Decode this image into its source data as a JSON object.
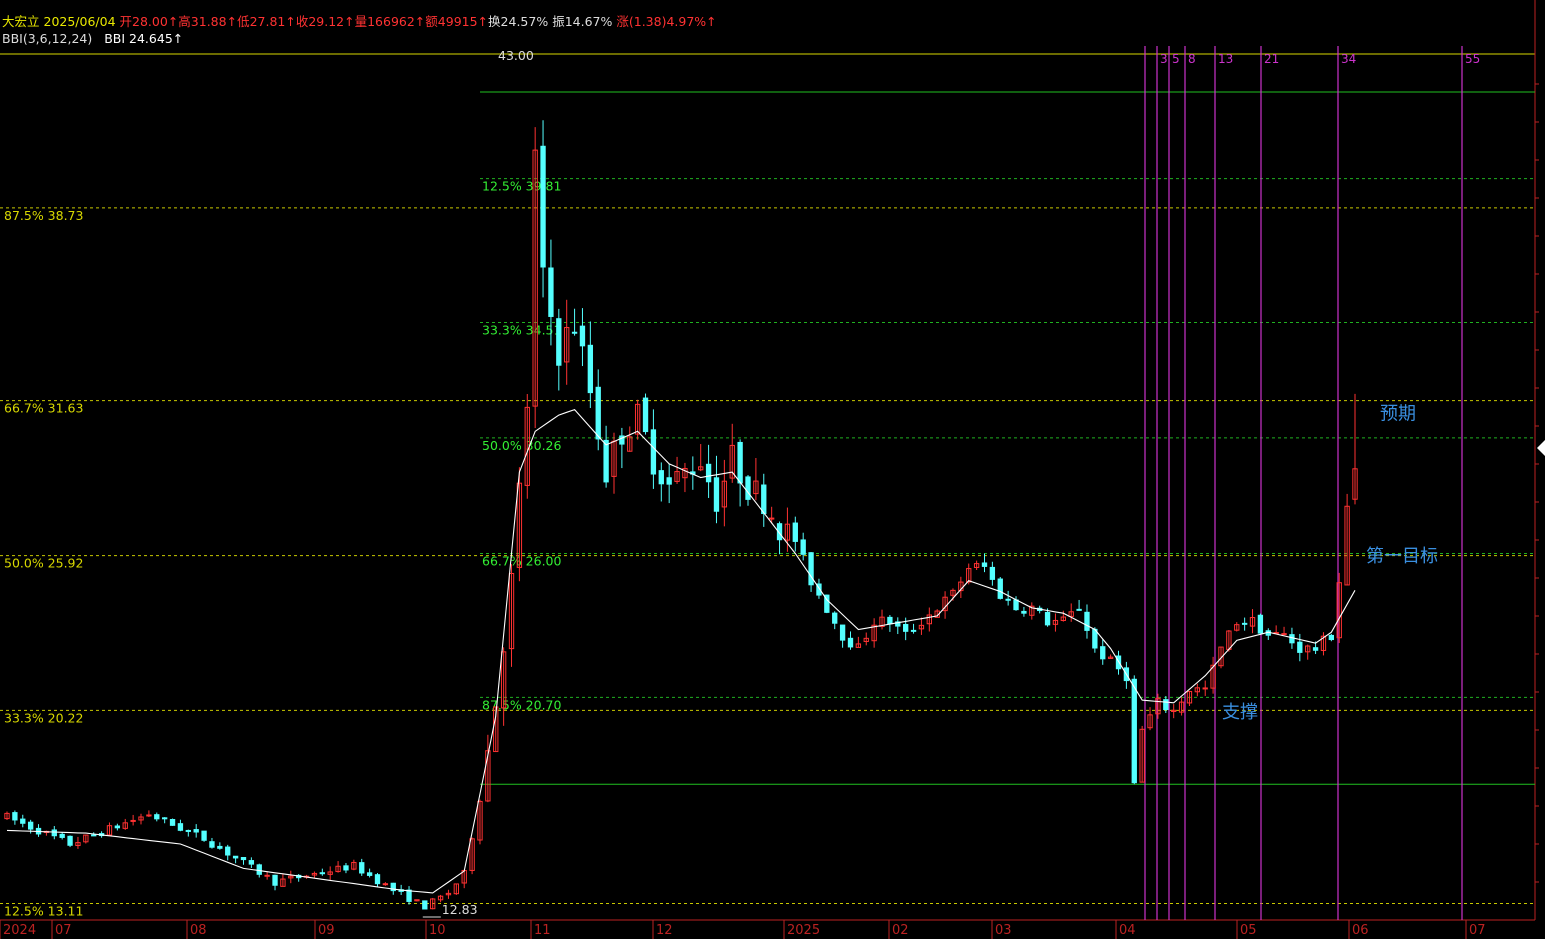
{
  "header": {
    "stock_name": "大宏立",
    "date": "2025/06/04",
    "open": "开28.00↑",
    "high": "高31.88↑",
    "low": "低27.81↑",
    "close": "收29.12↑",
    "volume": "量166962↑",
    "amount": "额49915↑",
    "turnover": "换24.57%",
    "amplitude": "振14.67%",
    "change": "涨(1.38)4.97%↑",
    "indicator_name": "BBI(3,6,12,24)",
    "indicator_value": "BBI 24.645↑"
  },
  "colors": {
    "background": "#000000",
    "up": "#ff3232",
    "down": "#54ffff",
    "fib_left": "#d8d800",
    "fib_right": "#33ee33",
    "fib_line_right": "#20c020",
    "time_lines": "#cc33cc",
    "bbi": "#ffffff",
    "annotation": "#3a8fe0",
    "axis": "#bb2222"
  },
  "chart_data": {
    "type": "candlestick",
    "y_scale": "linear",
    "ylim": [
      12.5,
      44.4
    ],
    "x_axis_labels": [
      "2024",
      "07",
      "08",
      "09",
      "10",
      "11",
      "12",
      "2025",
      "02",
      "03",
      "04",
      "05",
      "06",
      "07"
    ],
    "high_marker": "43.00",
    "low_marker": "12.83",
    "fib_left": [
      {
        "label": "87.5% 38.73",
        "value": 38.73
      },
      {
        "label": "66.7% 31.63",
        "value": 31.63
      },
      {
        "label": "50.0% 25.92",
        "value": 25.92
      },
      {
        "label": "33.3% 20.22",
        "value": 20.22
      },
      {
        "label": "12.5% 13.11",
        "value": 13.11
      }
    ],
    "fib_right": [
      {
        "label": "12.5% 39.81",
        "value": 39.81
      },
      {
        "label": "33.3% 34.51",
        "value": 34.51
      },
      {
        "label": "50.0% 30.26",
        "value": 30.26
      },
      {
        "label": "66.7% 26.00",
        "value": 26.0
      },
      {
        "label": "87.5% 20.70",
        "value": 20.7
      }
    ],
    "fib_right_base": 17.5,
    "time_lines": [
      "3",
      "5",
      "8",
      "13",
      "21",
      "34",
      "55"
    ],
    "annotations": [
      {
        "text": "预期",
        "price": 31.2
      },
      {
        "text": "第一目标",
        "price": 25.95
      },
      {
        "text": "支撑",
        "price": 20.2
      }
    ],
    "anchors": [
      [
        0,
        16.3
      ],
      [
        8,
        15.3
      ],
      [
        18,
        16.4
      ],
      [
        25,
        15.5
      ],
      [
        34,
        13.9
      ],
      [
        44,
        14.5
      ],
      [
        49,
        13.6
      ],
      [
        53,
        13.0
      ],
      [
        56,
        13.5
      ],
      [
        58,
        14.2
      ],
      [
        60,
        17.0
      ],
      [
        62,
        20.5
      ],
      [
        64,
        25.0
      ],
      [
        66,
        31.5
      ],
      [
        67,
        40.5
      ],
      [
        68,
        36.0
      ],
      [
        70,
        33.5
      ],
      [
        72,
        34.5
      ],
      [
        74,
        32.0
      ],
      [
        76,
        29.0
      ],
      [
        78,
        30.5
      ],
      [
        80,
        31.0
      ],
      [
        82,
        29.5
      ],
      [
        84,
        28.5
      ],
      [
        86,
        29.0
      ],
      [
        88,
        29.5
      ],
      [
        90,
        28.0
      ],
      [
        92,
        29.5
      ],
      [
        94,
        28.5
      ],
      [
        96,
        28.0
      ],
      [
        98,
        27.0
      ],
      [
        100,
        26.5
      ],
      [
        102,
        25.0
      ],
      [
        104,
        24.0
      ],
      [
        106,
        23.0
      ],
      [
        108,
        22.5
      ],
      [
        110,
        23.5
      ],
      [
        112,
        23.5
      ],
      [
        114,
        23.0
      ],
      [
        116,
        23.5
      ],
      [
        118,
        24.0
      ],
      [
        120,
        24.5
      ],
      [
        122,
        25.5
      ],
      [
        124,
        25.5
      ],
      [
        126,
        24.5
      ],
      [
        128,
        24.0
      ],
      [
        130,
        24.0
      ],
      [
        132,
        23.5
      ],
      [
        134,
        23.5
      ],
      [
        136,
        24.0
      ],
      [
        138,
        22.5
      ],
      [
        140,
        22.0
      ],
      [
        142,
        21.5
      ],
      [
        143,
        17.5
      ],
      [
        144,
        19.5
      ],
      [
        146,
        20.5
      ],
      [
        148,
        20.2
      ],
      [
        150,
        21.0
      ],
      [
        152,
        21.0
      ],
      [
        154,
        22.5
      ],
      [
        156,
        23.5
      ],
      [
        158,
        23.5
      ],
      [
        160,
        23.0
      ],
      [
        162,
        23.0
      ],
      [
        164,
        22.5
      ],
      [
        166,
        22.5
      ],
      [
        168,
        23.0
      ],
      [
        169,
        25.0
      ],
      [
        170,
        28.0
      ],
      [
        171,
        29.12
      ]
    ],
    "bbi_anchors": [
      [
        0,
        15.8
      ],
      [
        10,
        15.7
      ],
      [
        22,
        15.3
      ],
      [
        30,
        14.4
      ],
      [
        40,
        14.0
      ],
      [
        50,
        13.6
      ],
      [
        54,
        13.5
      ],
      [
        58,
        14.3
      ],
      [
        62,
        20.0
      ],
      [
        65,
        29.0
      ],
      [
        67,
        30.5
      ],
      [
        70,
        31.1
      ],
      [
        72,
        31.3
      ],
      [
        76,
        30.0
      ],
      [
        80,
        30.5
      ],
      [
        84,
        29.3
      ],
      [
        88,
        28.8
      ],
      [
        92,
        29.0
      ],
      [
        96,
        27.5
      ],
      [
        100,
        26.0
      ],
      [
        104,
        24.3
      ],
      [
        108,
        23.2
      ],
      [
        112,
        23.4
      ],
      [
        118,
        23.7
      ],
      [
        122,
        25.0
      ],
      [
        126,
        24.6
      ],
      [
        130,
        24.0
      ],
      [
        134,
        23.8
      ],
      [
        138,
        23.2
      ],
      [
        140,
        22.5
      ],
      [
        144,
        20.6
      ],
      [
        148,
        20.5
      ],
      [
        152,
        21.5
      ],
      [
        156,
        22.8
      ],
      [
        160,
        23.1
      ],
      [
        166,
        22.7
      ],
      [
        168,
        23.1
      ],
      [
        171,
        24.645
      ]
    ],
    "bar_count": 172,
    "volatility": 0.011,
    "seed": 7
  }
}
